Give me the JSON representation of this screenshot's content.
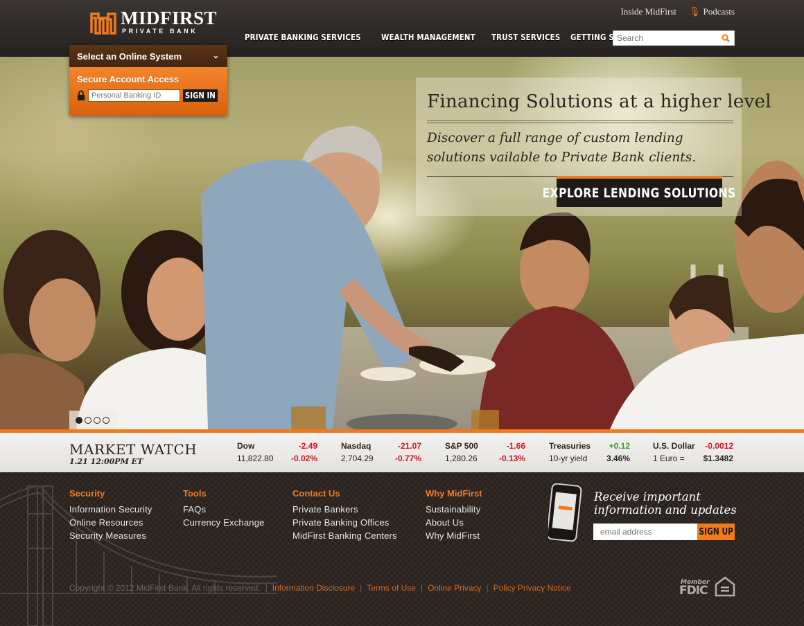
{
  "brand": {
    "name": "MIDFIRST",
    "tagline": "PRIVATE BANK",
    "accent": "#f07a1d"
  },
  "utility_nav": {
    "inside": "Inside MidFirst",
    "podcasts": "Podcasts"
  },
  "main_nav": [
    "PRIVATE BANKING SERVICES",
    "WEALTH MANAGEMENT",
    "TRUST SERVICES",
    "GETTING STARTED"
  ],
  "search": {
    "placeholder": "Search"
  },
  "login": {
    "select_label": "Select an Online System",
    "secure_label": "Secure Account Access",
    "id_placeholder": "Personal Banking ID",
    "signin_label": "SIGN IN"
  },
  "hero": {
    "title": "Financing Solutions at a higher level",
    "subtitle": "Discover a full range of custom lending solutions vailable to Private Bank clients.",
    "cta": "EXPLORE LENDING SOLUTIONS",
    "slides": 4,
    "active_slide": 1
  },
  "market": {
    "title": "MARKET WATCH",
    "time": "1.21 12:00PM ET",
    "quotes": [
      {
        "name": "Dow",
        "change": "-2.49",
        "value": "11,822.80",
        "pct": "-0.02%",
        "dir": "neg"
      },
      {
        "name": "Nasdaq",
        "change": "-21.07",
        "value": "2,704.29",
        "pct": "-0.77%",
        "dir": "neg"
      },
      {
        "name": "S&P 500",
        "change": "-1.66",
        "value": "1,280.26",
        "pct": "-0.13%",
        "dir": "neg"
      },
      {
        "name": "Treasuries",
        "change": "+0.12",
        "value": "10-yr yield",
        "pct": "3.46%",
        "dir": "pos"
      },
      {
        "name": "U.S. Dollar",
        "change": "-0.0012",
        "value": "1 Euro =",
        "pct": "$1.3482",
        "dir": "neg"
      }
    ]
  },
  "footer": {
    "columns": [
      {
        "heading": "Security",
        "links": [
          "Information Security",
          "Online Resources",
          "Security Measures"
        ]
      },
      {
        "heading": "Tools",
        "links": [
          "FAQs",
          "Currency Exchange"
        ]
      },
      {
        "heading": "Contact Us",
        "links": [
          "Private Bankers",
          "Private Banking Offices",
          "MidFirst Banking Centers"
        ]
      },
      {
        "heading": "Why MidFirst",
        "links": [
          "Sustainability",
          "About Us",
          "Why MidFirst"
        ]
      }
    ],
    "newsletter": {
      "line1": "Receive important",
      "line2": "information and updates",
      "placeholder": "email address",
      "button": "SIGN UP"
    },
    "copyright": "Copyright © 2012 MidFirst Bank. All rights reserved.",
    "legal_links": [
      "Information Disclosure",
      "Terms of Use",
      "Online Privacy",
      "Policy Privacy Notice"
    ],
    "fdic_member": "Member",
    "fdic": "FDIC"
  }
}
